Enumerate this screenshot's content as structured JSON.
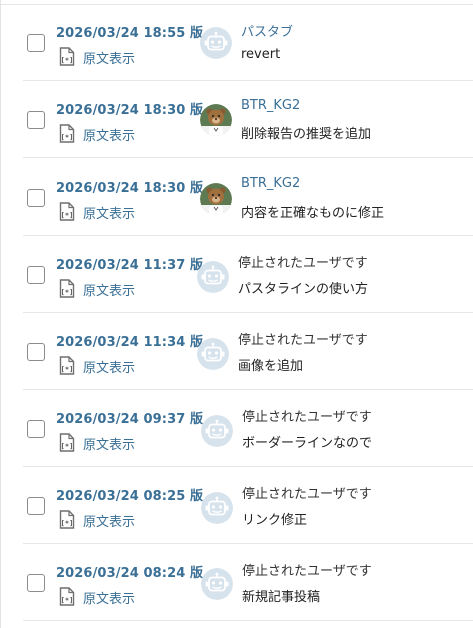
{
  "revisions": [
    {
      "version": "2026/03/24 18:55 版",
      "source_label": "原文表示",
      "user": "パスタブ",
      "user_linked": true,
      "avatar": "robot",
      "summary": "revert"
    },
    {
      "version": "2026/03/24 18:30 版",
      "source_label": "原文表示",
      "user": "BTR_KG2",
      "user_linked": true,
      "avatar": "bear",
      "summary": "削除報告の推奨を追加"
    },
    {
      "version": "2026/03/24 18:30 版",
      "source_label": "原文表示",
      "user": "BTR_KG2",
      "user_linked": true,
      "avatar": "bear",
      "summary": "内容を正確なものに修正"
    },
    {
      "version": "2026/03/24 11:37 版",
      "source_label": "原文表示",
      "user": "停止されたユーザです",
      "user_linked": false,
      "avatar": "robot",
      "summary": "パスタラインの使い方"
    },
    {
      "version": "2026/03/24 11:34 版",
      "source_label": "原文表示",
      "user": "停止されたユーザです",
      "user_linked": false,
      "avatar": "robot",
      "summary": "画像を追加"
    },
    {
      "version": "2026/03/24 09:37 版",
      "source_label": "原文表示",
      "user": "停止されたユーザです",
      "user_linked": false,
      "avatar": "robot",
      "summary": "ボーダーラインなので"
    },
    {
      "version": "2026/03/24 08:25 版",
      "source_label": "原文表示",
      "user": "停止されたユーザです",
      "user_linked": false,
      "avatar": "robot",
      "summary": "リンク修正"
    },
    {
      "version": "2026/03/24 08:24 版",
      "source_label": "原文表示",
      "user": "停止されたユーザです",
      "user_linked": false,
      "avatar": "robot",
      "summary": "新規記事投稿"
    }
  ],
  "colors": {
    "link": "#3a6f96",
    "text": "#222222",
    "divider": "#e6e6e6",
    "avatar_bg": "#d6e2ec"
  }
}
